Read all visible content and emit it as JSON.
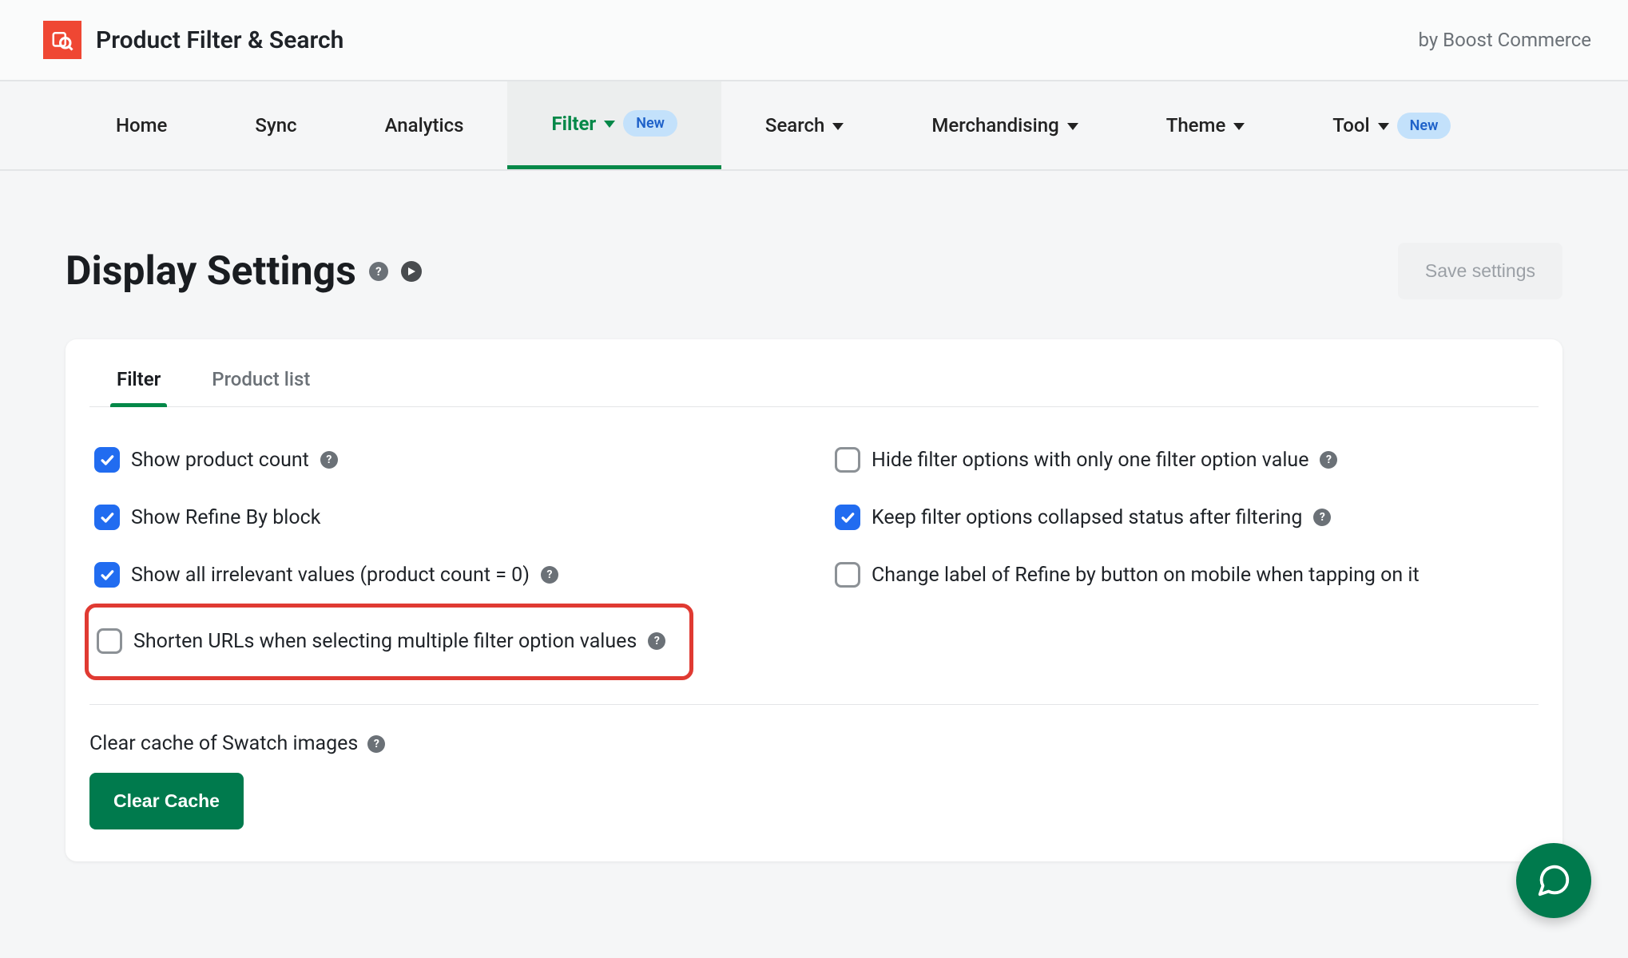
{
  "header": {
    "app_title": "Product Filter & Search",
    "vendor": "by Boost Commerce"
  },
  "nav": {
    "items": [
      {
        "label": "Home",
        "has_caret": false,
        "badge": null,
        "active": false
      },
      {
        "label": "Sync",
        "has_caret": false,
        "badge": null,
        "active": false
      },
      {
        "label": "Analytics",
        "has_caret": false,
        "badge": null,
        "active": false
      },
      {
        "label": "Filter",
        "has_caret": true,
        "badge": "New",
        "active": true
      },
      {
        "label": "Search",
        "has_caret": true,
        "badge": null,
        "active": false
      },
      {
        "label": "Merchandising",
        "has_caret": true,
        "badge": null,
        "active": false
      },
      {
        "label": "Theme",
        "has_caret": true,
        "badge": null,
        "active": false
      },
      {
        "label": "Tool",
        "has_caret": true,
        "badge": "New",
        "active": false
      }
    ]
  },
  "page": {
    "title": "Display Settings",
    "save_label": "Save settings"
  },
  "tabs": [
    {
      "label": "Filter",
      "active": true
    },
    {
      "label": "Product list",
      "active": false
    }
  ],
  "options_left": [
    {
      "label": "Show product count",
      "checked": true,
      "help": true,
      "highlight": false
    },
    {
      "label": "Show Refine By block",
      "checked": true,
      "help": false,
      "highlight": false
    },
    {
      "label": "Show all irrelevant values (product count = 0)",
      "checked": true,
      "help": true,
      "highlight": false
    },
    {
      "label": "Shorten URLs when selecting multiple filter option values",
      "checked": false,
      "help": true,
      "highlight": true
    }
  ],
  "options_right": [
    {
      "label": "Hide filter options with only one filter option value",
      "checked": false,
      "help": true
    },
    {
      "label": "Keep filter options collapsed status after filtering",
      "checked": true,
      "help": true
    },
    {
      "label": "Change label of Refine by button on mobile when tapping on it",
      "checked": false,
      "help": false
    }
  ],
  "clear_cache": {
    "label": "Clear cache of Swatch images",
    "button": "Clear Cache"
  }
}
